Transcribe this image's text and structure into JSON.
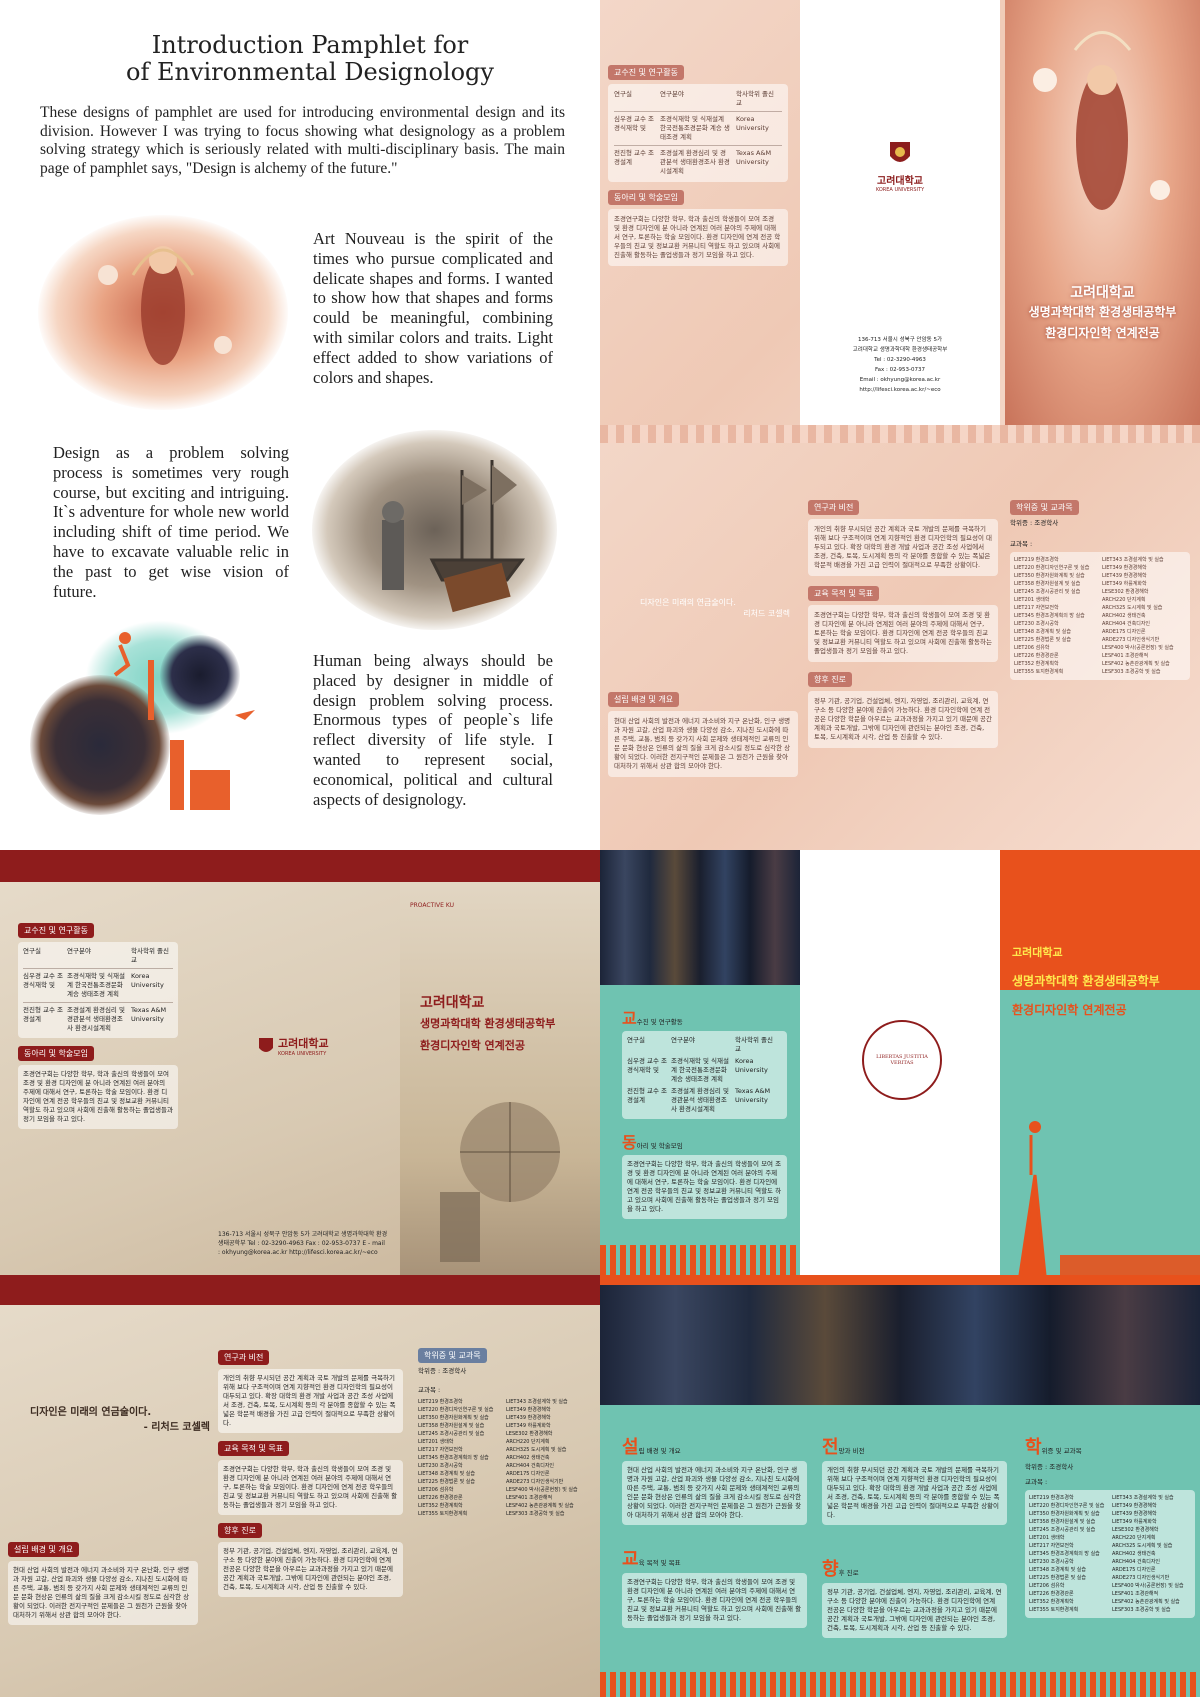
{
  "intro": {
    "title_line1": "Introduction Pamphlet for",
    "title_line2": "of Environmental Designology",
    "paragraph": "These designs of pamphlet are used for introducing environmental design and its division. However I was trying to focus showing what designology as a problem solving strategy which is seriously related with multi-disciplinary basis. The main page of pamphlet says, \"Design is alchemy of the future.\"",
    "art_nouveau": "Art Nouveau is the spirit of the times who pursue complicated and delicate shapes and forms. I wanted to show how that shapes and forms could be meaningful, combining with similar colors and traits. Light effect added to show variations of colors and shapes.",
    "problem_solving": "Design as a problem solving process is sometimes very rough course, but exciting and intriguing. It`s adventure for whole new world including shift of time period. We have to excavate valuable relic in the past to get wise vision of future.",
    "human_being": "Human being always should be placed by designer in middle of design problem solving process. Enormous types of people`s life reflect diversity of life style. I wanted to represent social, economical, political and cultural aspects of designology."
  },
  "brochure": {
    "university": "고려대학교",
    "university_en": "KOREA UNIVERSITY",
    "college": "생명과학대학 환경생태공학부",
    "program": "환경디자인학 연계전공",
    "quote": "디자인은 미래의 연금술이다.",
    "quote_author": "- 리처드 코셀렉",
    "quote_author_short": "리처드 코셀렉",
    "sections": {
      "faculty": "교수진 및 연구활동",
      "clubs": "동아리 및 학술모임",
      "background": "설립 배경 및 개요",
      "vision": "연구과 비전",
      "goals": "교육 목적 및 목표",
      "career": "향후 진로",
      "courses": "학위증 및 교과목",
      "degree": "학위증 : 조경학사",
      "subjects": "교과목 :"
    },
    "address": "136-713 서울시 성북구 안암동 5가",
    "address2": "고려대학교 생명과학대학 환경생태공학부",
    "tel": "Tel : 02-3290-4963",
    "fax": "Fax : 02-953-0737",
    "email": "Email : okhyung@korea.ac.kr",
    "web": "http://lifesci.korea.ac.kr/~eco",
    "address_full": "136-713 서울시 성북구 안암동 5가 고려대학교 생명과학대학 환경생태공학부 Tel : 02-3290-4963 Fax : 02-953-0737 E - mail : okhyung@korea.ac.kr http://lifesci.korea.ac.kr/~eco",
    "proactive": "PROACTIVE KU",
    "seal_text": "LIBERTAS JUSTITIA VERITAS",
    "teal_head1": "고려대학교",
    "teal_head2": "생명과학대학 환경생태공학부",
    "teal_head3": "환경디자인학 연계전공",
    "teal_letters": {
      "faculty": "교",
      "clubs": "동",
      "background": "설",
      "vision": "전",
      "courses": "학",
      "goals": "교",
      "career": "향"
    },
    "teal_titles": {
      "faculty": "수진 및 연구활동",
      "clubs": "아리 및 학술모임",
      "background": "립 배경 및 개요",
      "vision": "망과 비전",
      "courses": "위증 및 교과목",
      "goals": "육 목적 및 목표",
      "career": "후 진로"
    },
    "faculty_table": {
      "headers": [
        "연구실",
        "연구분야",
        "학사학위 졸신교"
      ],
      "rows": [
        [
          "심우경 교수 조경식재학 및",
          "조경식재학 및 식재설계 한국전통조경문화 계승 생태조경 계획",
          "Korea University"
        ],
        [
          "전진형 교수 조경설계",
          "조경설계 환경심리 및 경관분석 생태환경조사 환경시설계획",
          "Texas A&M University"
        ]
      ]
    },
    "courses_left": [
      "LIET219 환경조경학",
      "LIET220 환경디자인연구론 및 실습",
      "LIET350 환경자원화계획 및 실습",
      "LIET358 환경자원설계 및 실습",
      "LIET245 조경시공관리 및 실습",
      "LIET201 생태학",
      "LIET217 자연보전학",
      "LIET345 환경조경계획의 방 실습",
      "LIET230 조경시공학",
      "LIET348 조경계획 및 실습",
      "LIET225 환경법론 및 실습",
      "LIET206 섬유학",
      "LIET226 환경경관론",
      "LIET352 환경계획학",
      "LIET355 토지환경계획"
    ],
    "courses_right": [
      "LIET343 조경설계학 및 실습",
      "LIET349 환경경해학",
      "LIET439 환경경해학",
      "LIET349 하를계화학",
      "LESE302 환경경해학",
      "ARCH220 단지계획",
      "ARCH325 도시계획 및 실습",
      "ARCH402 생태건축",
      "ARCH404 건축디자인",
      "ARDE175 디자인론",
      "ARDE273 디자인생식기반",
      "LESF400 박사(공론현장) 및 실습",
      "LESF401 조경관해적",
      "LESF402 농촌관광계획 및 실습",
      "LESF303 조경공학 및 실습"
    ],
    "body_filler": "현대 산업 사회의 발전과 에너지 과소비와 지구 온난화, 인구 생명과 자원 고갈, 산업 파괴와 생물 다양성 감소, 지나친 도시화에 따른 주택, 교통, 범죄 등 갖가지 사회 문제와 생태계적인 교류의 인문 문화 현상은 인류의 삶의 질을 크게 감소시킬 정도로 심각한 상황이 되었다. 이러한 전지구적인 문제들은 그 원천가 근원을 찾아 대처하기 위해서 상관 합의 모아야 한다.",
    "clubs_filler": "조경연구회는 다양한 학부, 학과 출신의 학생들이 모여 조경 및 환경 디자인에 분 아니라 연계된 여러 분야의 주제에 대해서 연구, 토론하는 학술 모임이다. 환경 디자인에 연계 전공 학우들의 친교 및 정보교환 커뮤니티 역할도 하고 있으며 사회에 진출해 활동하는 졸업생들과 정기 모임을 하고 있다.",
    "career_filler": "정부 기관, 공기업, 건설업체, 엔지, 자영업, 조리관리, 교육계, 연구소 등 다양한 분야에 진출이 가능하다. 환경 디자인학에 연계 전공은 다양한 학문을 아우르는 교과과정을 가지고 있기 때문에 공간 계획과 국토개발, 그밖에 디자인에 관련되는 분야인 조경, 건축, 토목, 도시계획과 시각, 산업 등 진출할 수 있다.",
    "vision_filler": "개인의 취향 무시되던 공간 계획과 국토 개발의 문제를 극복하기 위해 보다 구조적이며 연계 지향적인 환경 디자인학의 필요성이 대두되고 있다. 확장 대학의 환경 개발 사업과 공간 조성 사업에서 조경, 건축, 토목, 도시계획 등의 각 분야를 종합할 수 있는 폭넓은 학문적 배경을 가진 고급 인력이 절대적으로 부족한 상황이다."
  }
}
